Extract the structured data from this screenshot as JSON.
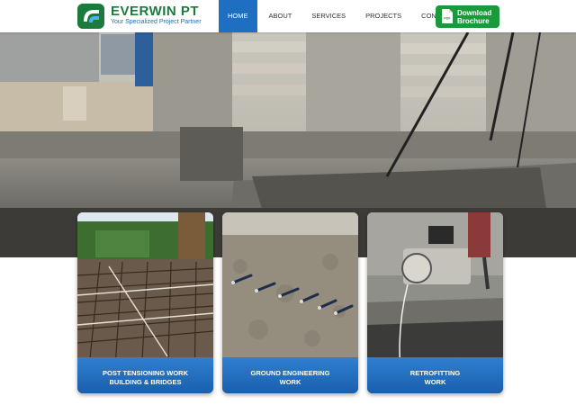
{
  "brand": {
    "name": "EVERWIN PT",
    "tagline": "Your Specialized Project Partner"
  },
  "nav": {
    "items": [
      {
        "label": "HOME",
        "active": true
      },
      {
        "label": "ABOUT",
        "active": false
      },
      {
        "label": "SERVICES",
        "active": false
      },
      {
        "label": "PROJECTS",
        "active": false
      },
      {
        "label": "CONTACT",
        "active": false
      }
    ]
  },
  "download": {
    "icon_text": "PDF",
    "line1": "Download",
    "line2": "Brochure"
  },
  "services": [
    {
      "title": "POST TENSIONING WORK\nBUILDING & BRIDGES"
    },
    {
      "title": "GROUND ENGINEERING\nWORK"
    },
    {
      "title": "RETROFITTING\nWORK"
    }
  ],
  "colors": {
    "brand_green": "#1b7a3c",
    "brand_blue": "#1e6fc1",
    "button_green": "#1a9a3a",
    "card_label_blue": "#1f68b8"
  }
}
